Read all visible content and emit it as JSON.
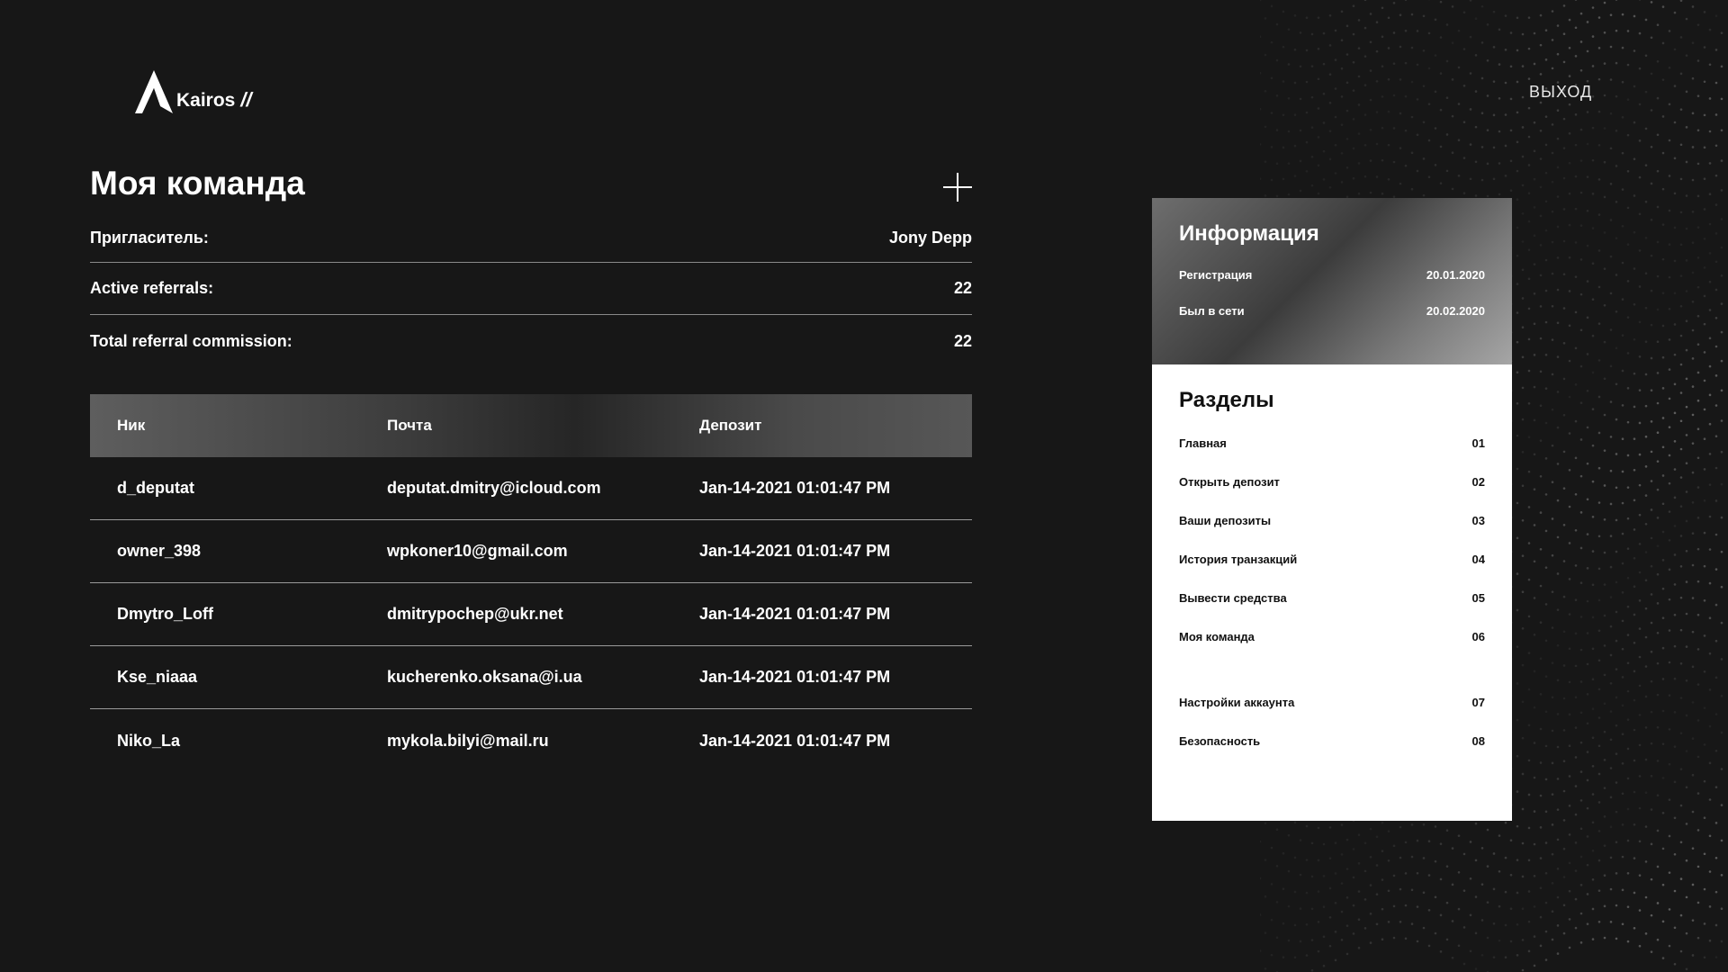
{
  "brand": {
    "name": "Kairos",
    "suffix": "//"
  },
  "header": {
    "logout_label": "ВЫХОД"
  },
  "page": {
    "title": "Моя команда"
  },
  "stats": [
    {
      "label": "Пригласитель:",
      "value": "Jony Depp"
    },
    {
      "label": "Active referrals:",
      "value": "22"
    },
    {
      "label": "Total referral commission:",
      "value": "22"
    }
  ],
  "table": {
    "headers": [
      "Ник",
      "Почта",
      "Депозит"
    ],
    "rows": [
      {
        "nick": "d_deputat",
        "email": "deputat.dmitry@icloud.com",
        "deposit": "Jan-14-2021 01:01:47 PM"
      },
      {
        "nick": "owner_398",
        "email": "wpkoner10@gmail.com",
        "deposit": "Jan-14-2021 01:01:47 PM"
      },
      {
        "nick": "Dmytro_Loff",
        "email": "dmitrypochep@ukr.net",
        "deposit": "Jan-14-2021 01:01:47 PM"
      },
      {
        "nick": "Kse_niaaa",
        "email": "kucherenko.oksana@i.ua",
        "deposit": "Jan-14-2021 01:01:47 PM"
      },
      {
        "nick": "Niko_La",
        "email": "mykola.bilyi@mail.ru",
        "deposit": "Jan-14-2021 01:01:47 PM"
      }
    ]
  },
  "info": {
    "title": "Информация",
    "rows": [
      {
        "label": "Регистрация",
        "value": "20.01.2020"
      },
      {
        "label": "Был в сети",
        "value": "20.02.2020"
      }
    ]
  },
  "sections": {
    "title": "Разделы",
    "items": [
      {
        "label": "Главная",
        "num": "01"
      },
      {
        "label": "Открыть депозит",
        "num": "02"
      },
      {
        "label": "Ваши депозиты",
        "num": "03"
      },
      {
        "label": "История транзакций",
        "num": "04"
      },
      {
        "label": "Вывести средства",
        "num": "05"
      },
      {
        "label": "Моя команда",
        "num": "06"
      }
    ],
    "extra_items": [
      {
        "label": "Настройки аккаунта",
        "num": "07"
      },
      {
        "label": "Безопасность",
        "num": "08"
      }
    ]
  },
  "icons": {
    "logo": "kairos-logo-icon",
    "add": "plus-icon"
  }
}
